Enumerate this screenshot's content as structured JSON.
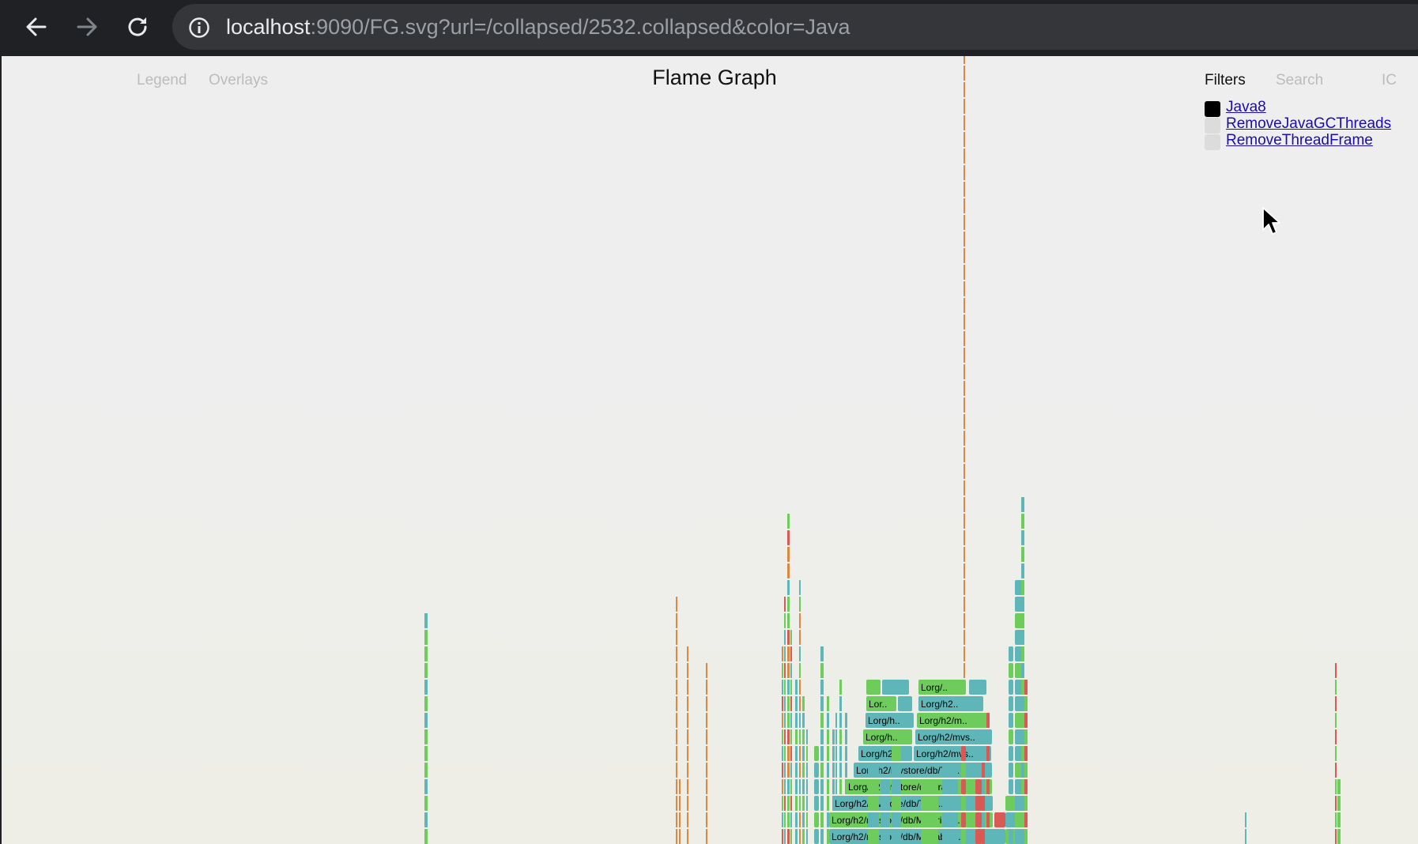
{
  "browser": {
    "url_host": "localhost",
    "url_rest": ":9090/FG.svg?url=/collapsed/2532.collapsed&color=Java",
    "icons": [
      "back-arrow-icon",
      "forward-arrow-icon",
      "reload-icon",
      "info-icon",
      "mouse-cursor-icon"
    ]
  },
  "header": {
    "title": "Flame Graph",
    "legend_label": "Legend",
    "overlays_label": "Overlays",
    "filters_label": "Filters",
    "search_label": "Search",
    "ic_label": "IC"
  },
  "filters": [
    {
      "label": "Java8",
      "checked": true
    },
    {
      "label": "RemoveJavaGCThreads",
      "checked": false
    },
    {
      "label": "RemoveThreadFrame",
      "checked": false
    }
  ],
  "flame_labels": [
    "Lorg/..",
    "Lor..",
    "Lorg/h2..",
    "Lorg/h..",
    "Lorg/h2/m..",
    "Lorg/h..",
    "Lorg/h2/mvs..",
    "Lorg/h2..",
    "Lorg/h2/mvs..",
    "Lorg/h2/mvstore/db/Tra..",
    "Lorg/h2/mvstore/db/Tran..",
    "Lorg/h2/mvstore/db/Tran..",
    "Lorg/h2/mvstore/db/MVPrima..",
    "Lorg/h2/mvstore/db/MVTable::.."
  ],
  "colors": {
    "java_green": "#6dcc5c",
    "inlined_teal": "#5fb6b8",
    "kernel_orange": "#d98a40",
    "native_red": "#d95a55",
    "filter_checked": "#000000",
    "filter_unchecked": "#dcdcdc",
    "link": "#1a0dab"
  }
}
